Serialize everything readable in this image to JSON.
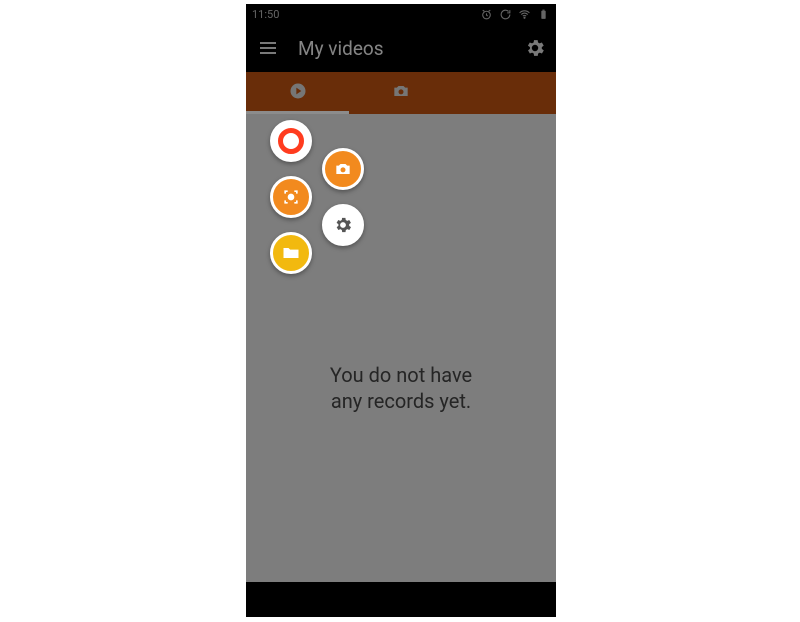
{
  "status": {
    "time": "11:50"
  },
  "appbar": {
    "title": "My videos"
  },
  "empty": {
    "line1": "You do not have",
    "line2": "any records yet."
  },
  "colors": {
    "tab_bg": "#c05312",
    "fab_orange": "#f28a1e",
    "fab_yellow": "#f2b90f",
    "fab_red": "#ff3c1f"
  }
}
